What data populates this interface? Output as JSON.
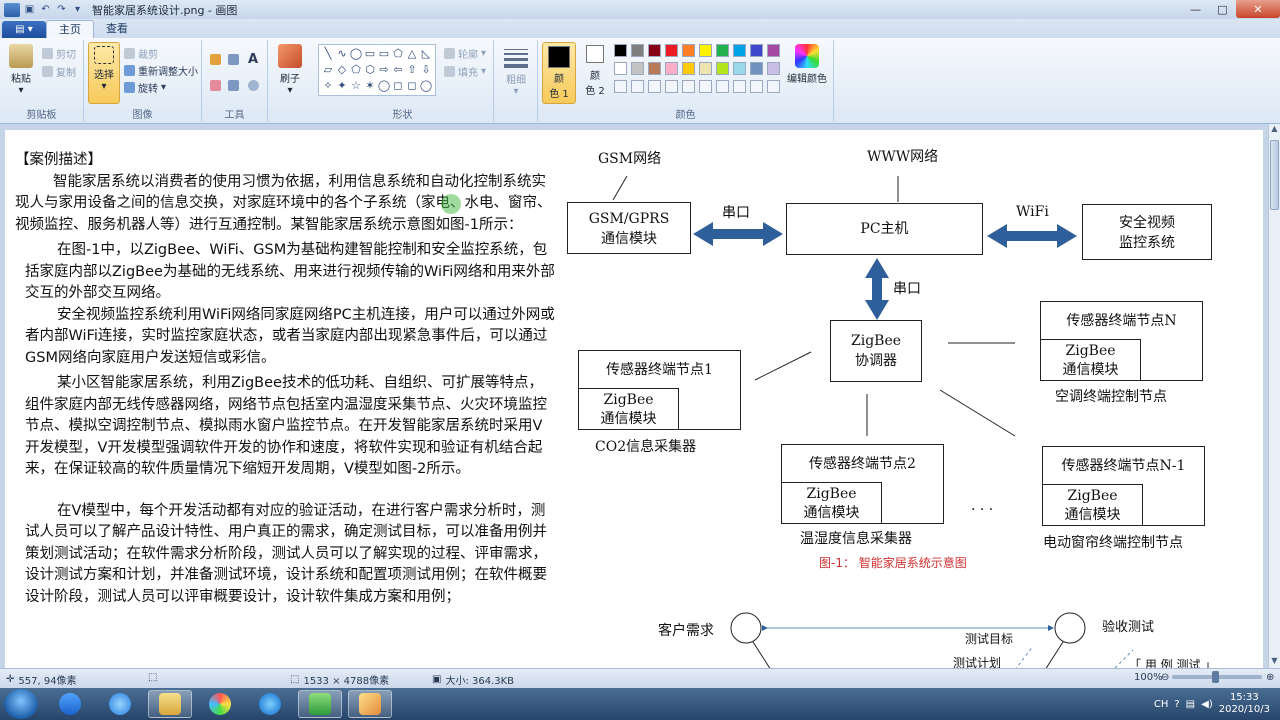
{
  "window": {
    "title": "智能家居系统设计.png - 画图",
    "controls": [
      "—",
      "□",
      "✕"
    ]
  },
  "menu": {
    "file": "▤ ▾",
    "tabs": [
      "主页",
      "查看"
    ]
  },
  "ribbon": {
    "clipboard": {
      "label": "剪贴板",
      "paste": "粘贴",
      "cut": "剪切",
      "copy": "复制"
    },
    "image": {
      "label": "图像",
      "select": "选择",
      "crop": "裁剪",
      "resize": "重新调整大小",
      "rotate": "旋转"
    },
    "tools": {
      "label": "工具"
    },
    "brushes": {
      "label": "刷子"
    },
    "shapes": {
      "label": "形状",
      "outline": "轮廓",
      "fill": "填充",
      "glyphs": [
        "╲",
        "∿",
        "◯",
        "▭",
        "▭",
        "⬠",
        "△",
        "◺",
        "▱",
        "◇",
        "⬠",
        "⬡",
        "⇨",
        "⇦",
        "⇧",
        "⇩",
        "✧",
        "✦",
        "☆",
        "✶",
        "◯",
        "◻",
        "◻",
        "◯"
      ]
    },
    "size": {
      "label": "粗细"
    },
    "colors": {
      "label": "颜色",
      "color1": "颜\n色 1",
      "color2": "颜\n色 2",
      "edit": "编辑颜色",
      "palette_row1": [
        "#000000",
        "#7f7f7f",
        "#880015",
        "#ed1c24",
        "#ff7f27",
        "#fff200",
        "#22b14c",
        "#00a2e8",
        "#3f48cc",
        "#a349a4"
      ],
      "palette_row2": [
        "#ffffff",
        "#c3c3c3",
        "#b97a57",
        "#ffaec9",
        "#ffc90e",
        "#efe4b0",
        "#b5e61d",
        "#99d9ea",
        "#7092be",
        "#c8bfe7"
      ]
    }
  },
  "document": {
    "heading": "【案例描述】",
    "p1": "智能家居系统以消费者的使用习惯为依据，利用信息系统和自动化控制系统实现人与家用设备之间的信息交换，对家庭环境中的各个子系统（家电、水电、窗帘、视频监控、服务机器人等）进行互通控制。某智能家居系统示意图如图-1所示：",
    "p2": "在图-1中，以ZigBee、WiFi、GSM为基础构建智能控制和安全监控系统，包括家庭内部以ZigBee为基础的无线系统、用来进行视频传输的WiFi网络和用来外部交互的外部交互网络。",
    "p3": "安全视频监控系统利用WiFi网络同家庭网络PC主机连接，用户可以通过外网或者内部WiFi连接，实时监控家庭状态，或者当家庭内部出现紧急事件后，可以通过GSM网络向家庭用户发送短信或彩信。",
    "p4": "某小区智能家居系统，利用ZigBee技术的低功耗、自组织、可扩展等特点，组件家庭内部无线传感器网络，网络节点包括室内温湿度采集节点、火灾环境监控节点、模拟空调控制节点、模拟雨水窗户监控节点。在开发智能家居系统时采用V开发模型，V开发模型强调软件开发的协作和速度，将软件实现和验证有机结合起来，在保证较高的软件质量情况下缩短开发周期，V模型如图-2所示。",
    "p5": "在V模型中，每个开发活动都有对应的验证活动，在进行客户需求分析时，测试人员可以了解产品设计特性、用户真正的需求，确定测试目标，可以准备用例并策划测试活动；在软件需求分析阶段，测试人员可以了解实现的过程、评审需求，设计测试方案和计划，并准备测试环境，设计系统和配置项测试用例；在软件概要设计阶段，测试人员可以评审概要设计，设计软件集成方案和用例；"
  },
  "diagram": {
    "gsm_net": "GSM网络",
    "www_net": "WWW网络",
    "gsm_module_1": "GSM/GPRS",
    "gsm_module_2": "通信模块",
    "serial_1": "串口",
    "pc_host": "PC主机",
    "wifi": "WiFi",
    "video_1": "安全视频",
    "video_2": "监控系统",
    "serial_2": "串口",
    "coord_1": "ZigBee",
    "coord_2": "协调器",
    "node1_title": "传感器终端节点1",
    "node1_mod_1": "ZigBee",
    "node1_mod_2": "通信模块",
    "node1_caption": "CO2信息采集器",
    "nodeN_title": "传感器终端节点N",
    "nodeN_mod_1": "ZigBee",
    "nodeN_mod_2": "通信模块",
    "nodeN_caption": "空调终端控制节点",
    "node2_title": "传感器终端节点2",
    "node2_mod_1": "ZigBee",
    "node2_mod_2": "通信模块",
    "node2_caption": "温湿度信息采集器",
    "nodeN1_title": "传感器终端节点N-1",
    "nodeN1_mod_1": "ZigBee",
    "nodeN1_mod_2": "通信模块",
    "nodeN1_caption": "电动窗帘终端控制节点",
    "dots": "·  ·  ·",
    "caption": "图-1：  智能家居系统示意图"
  },
  "vmodel": {
    "left_top": "客户需求",
    "right_top": "验收测试",
    "target": "测试目标",
    "plan": "测试计划",
    "cut": "「 用 例 测试 」"
  },
  "statusbar": {
    "cursor": "557, 94像素",
    "dimensions": "1533 × 4788像素",
    "filesize": "大小: 364.3KB",
    "zoom": "100%",
    "zoom_level": 1.0
  },
  "taskbar": {
    "time": "15:33",
    "date": "2020/10/3"
  }
}
